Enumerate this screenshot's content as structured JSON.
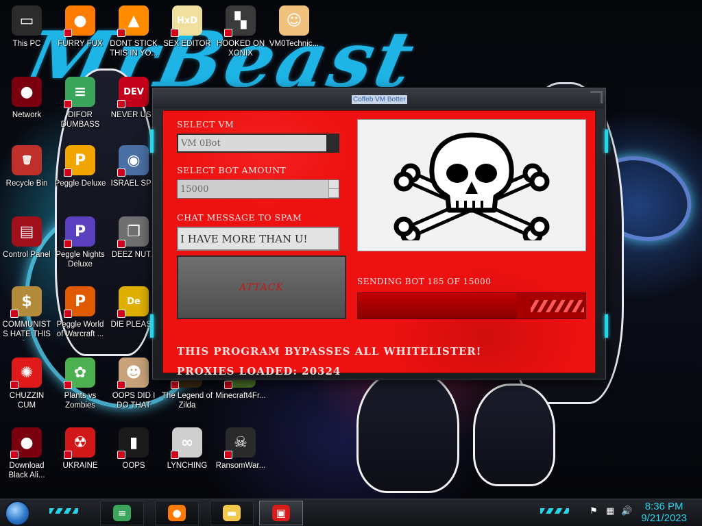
{
  "wallpaper": {
    "title": "MrBeast"
  },
  "desktop": {
    "icons": [
      {
        "label": "This PC",
        "icon": "monitor-icon",
        "color": "#2b2b2b",
        "glyph": "▭",
        "shortcut": false
      },
      {
        "label": "FURRY FUX",
        "icon": "firefox-icon",
        "color": "#ff7a00",
        "glyph": "●",
        "shortcut": true
      },
      {
        "label": "DONT STICK THIS IN YO...",
        "icon": "vlc-cone-icon",
        "color": "#ff8c00",
        "glyph": "▲",
        "shortcut": true
      },
      {
        "label": "SEX EDITOR",
        "icon": "hxd-icon",
        "color": "#f0e0a0",
        "glyph": "HxD",
        "shortcut": true
      },
      {
        "label": "HOOKED ON XONIX",
        "icon": "xonix-icon",
        "color": "#3a3a3a",
        "glyph": "▚",
        "shortcut": true
      },
      {
        "label": "VM0Technic...",
        "icon": "doctor-icon",
        "color": "#f1c27d",
        "glyph": "☺",
        "shortcut": false
      },
      {
        "label": "Network",
        "icon": "network-orb-icon",
        "color": "#7a0010",
        "glyph": "●",
        "shortcut": false
      },
      {
        "label": "DIFOR DUMBASS",
        "icon": "discord-icon",
        "color": "#3ba55c",
        "glyph": "≡",
        "shortcut": true
      },
      {
        "label": "NEVER USE",
        "icon": "dev-cpp-icon",
        "color": "#c4001a",
        "glyph": "DEV",
        "shortcut": true
      },
      {
        "label": "Recycle Bin",
        "icon": "recycle-bin-icon",
        "color": "#c0302a",
        "glyph": "🗑",
        "shortcut": false
      },
      {
        "label": "Peggle Deluxe",
        "icon": "peggle-icon",
        "color": "#f2a400",
        "glyph": "P",
        "shortcut": true
      },
      {
        "label": "ISRAEL SPY",
        "icon": "spy-icon",
        "color": "#4a6fa5",
        "glyph": "◉",
        "shortcut": true
      },
      {
        "label": "Control Panel",
        "icon": "control-panel-icon",
        "color": "#a0101a",
        "glyph": "▤",
        "shortcut": false
      },
      {
        "label": "Peggle Nights Deluxe",
        "icon": "peggle-nights-icon",
        "color": "#5a3fbf",
        "glyph": "P",
        "shortcut": true
      },
      {
        "label": "DEEZ NUTZ",
        "icon": "window-stack-icon",
        "color": "#6f6f6f",
        "glyph": "❐",
        "shortcut": true
      },
      {
        "label": "COMMUNISTS HATE THIS G...",
        "icon": "money-bag-icon",
        "color": "#b48a3b",
        "glyph": "$",
        "shortcut": true
      },
      {
        "label": "Peggle World of Warcraft ...",
        "icon": "peggle-wow-icon",
        "color": "#e05a00",
        "glyph": "P",
        "shortcut": true
      },
      {
        "label": "DIE PLEASE",
        "icon": "de-icon",
        "color": "#e0b000",
        "glyph": "De",
        "shortcut": true
      },
      {
        "label": "CHUZZIN CUM",
        "icon": "chuzzle-icon",
        "color": "#e01a1a",
        "glyph": "✺",
        "shortcut": true
      },
      {
        "label": "Plants vs Zombies",
        "icon": "plant-icon",
        "color": "#4caf50",
        "glyph": "✿",
        "shortcut": true
      },
      {
        "label": "OOPS DID I DO THAT",
        "icon": "portrait-icon",
        "color": "#c8a27a",
        "glyph": "☻",
        "shortcut": true
      },
      {
        "label": "The Legend of Zilda",
        "icon": "zelda-icon",
        "color": "#3d2a12",
        "glyph": "◆",
        "shortcut": true
      },
      {
        "label": "Minecraft4Fr...",
        "icon": "minecraft-icon",
        "color": "#4e7a2a",
        "glyph": "■",
        "shortcut": true
      },
      {
        "label": "Download Black Ali...",
        "icon": "red-orb-icon",
        "color": "#7a0010",
        "glyph": "●",
        "shortcut": true
      },
      {
        "label": "UKRAINE",
        "icon": "radiation-icon",
        "color": "#d01818",
        "glyph": "☢",
        "shortcut": true
      },
      {
        "label": "OOPS",
        "icon": "cmd-icon",
        "color": "#1a1a1a",
        "glyph": "▮",
        "shortcut": true
      },
      {
        "label": "LYNCHING",
        "icon": "rope-icon",
        "color": "#cfcfcf",
        "glyph": "∞",
        "shortcut": true
      },
      {
        "label": "RansomWar...",
        "icon": "skull-icon",
        "color": "#2a2a2a",
        "glyph": "☠",
        "shortcut": true
      }
    ]
  },
  "window": {
    "title": "Coffeb VM Botter",
    "select_vm_label": "SELECT VM",
    "select_vm_value": "VM 0Bot",
    "bot_amount_label": "SELECT BOT AMOUNT",
    "bot_amount_value": "15000",
    "chat_label": "CHAT MESSAGE TO SPAM",
    "chat_value": "I HAVE MORE THAN U!",
    "attack_label": "ATTACK",
    "status_text": "SENDING BOT 185 OF 15000",
    "progress_fraction": 0.7,
    "warning_text": "THIS PROGRAM BYPASSES ALL WHITELISTER!",
    "proxies_text": "PROXIES LOADED: 20324",
    "image_icon": "skull-crossbones-icon",
    "accent_color": "#27d5ea",
    "panel_color": "#ee1111"
  },
  "taskbar": {
    "apps": [
      {
        "name": "discord",
        "icon": "discord-icon",
        "color": "#3ba55c",
        "glyph": "≡"
      },
      {
        "name": "firefox",
        "icon": "firefox-icon",
        "color": "#ff7a00",
        "glyph": "●"
      },
      {
        "name": "file-explorer",
        "icon": "folder-icon",
        "color": "#f2c94c",
        "glyph": "▬"
      },
      {
        "name": "vm-botter",
        "icon": "app-window-icon",
        "color": "#d81b1b",
        "glyph": "▣"
      }
    ],
    "tray": [
      {
        "name": "flag",
        "icon": "flag-icon",
        "glyph": "⚑"
      },
      {
        "name": "network",
        "icon": "network-icon",
        "glyph": "▦"
      },
      {
        "name": "volume",
        "icon": "speaker-icon",
        "glyph": "🔊"
      }
    ],
    "time": "8:36 PM",
    "date": "9/21/2023"
  }
}
